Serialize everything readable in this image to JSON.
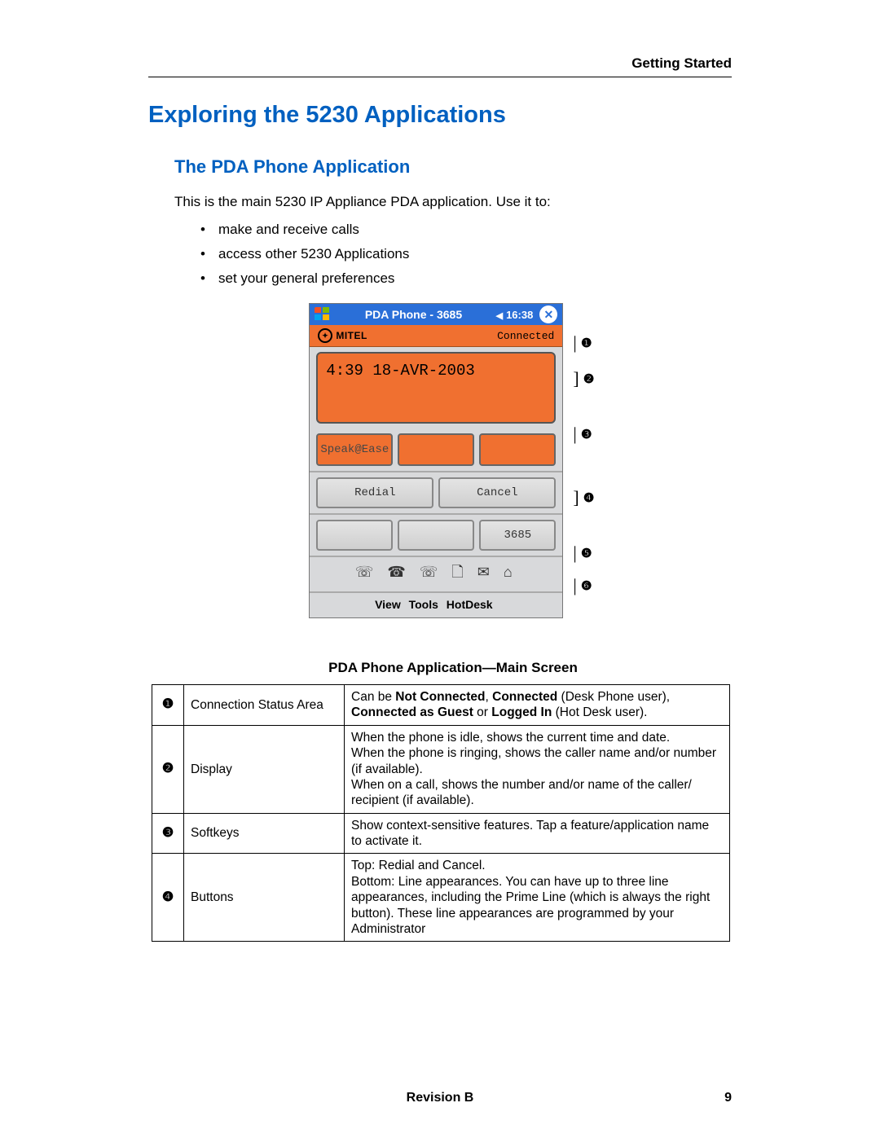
{
  "header": {
    "section": "Getting Started"
  },
  "title": "Exploring the 5230 Applications",
  "subtitle": "The PDA Phone Application",
  "intro": "This is the main 5230 IP Appliance PDA application. Use it to:",
  "bullets": [
    "make and receive calls",
    "access other 5230 Applications",
    "set your general preferences"
  ],
  "pda": {
    "titlebar": "PDA Phone - 3685",
    "time": "16:38",
    "brand": "MITEL",
    "status": "Connected",
    "display": "4:39 18-AVR-2003",
    "softkeys": [
      "Speak@Ease",
      "",
      ""
    ],
    "buttons": {
      "redial": "Redial",
      "cancel": "Cancel"
    },
    "lines": [
      "",
      "",
      "3685"
    ],
    "telephony_icons": "☏ ☎ ☏ 🗋 ✉ ⌂",
    "menus": [
      "View",
      "Tools",
      "HotDesk"
    ]
  },
  "callouts": [
    "❶",
    "❷",
    "❸",
    "❹",
    "❺",
    "❻"
  ],
  "caption": "PDA Phone Application—Main Screen",
  "table": [
    {
      "n": "❶",
      "label": "Connection Status Area",
      "desc_html": "Can be <b>Not Connected</b>, <b>Connected</b> (Desk Phone user), <b>Connected as Guest</b> or <b>Logged In</b> (Hot Desk user)."
    },
    {
      "n": "❷",
      "label": "Display",
      "desc_html": "When the phone is idle, shows the current time and date.<br>When the phone is ringing, shows the caller name and/or number (if available).<br>When on a call, shows the number and/or name of the caller/ recipient (if available)."
    },
    {
      "n": "❸",
      "label": "Softkeys",
      "desc_html": "Show context-sensitive features. Tap a feature/application name to activate it."
    },
    {
      "n": "❹",
      "label": "Buttons",
      "desc_html": "Top: Redial and Cancel.<br>Bottom: Line appearances. You can have up to three line appearances, including the Prime Line (which is always the right button). These line appearances are programmed by your Administrator"
    }
  ],
  "footer": {
    "revision": "Revision B",
    "page": "9"
  }
}
